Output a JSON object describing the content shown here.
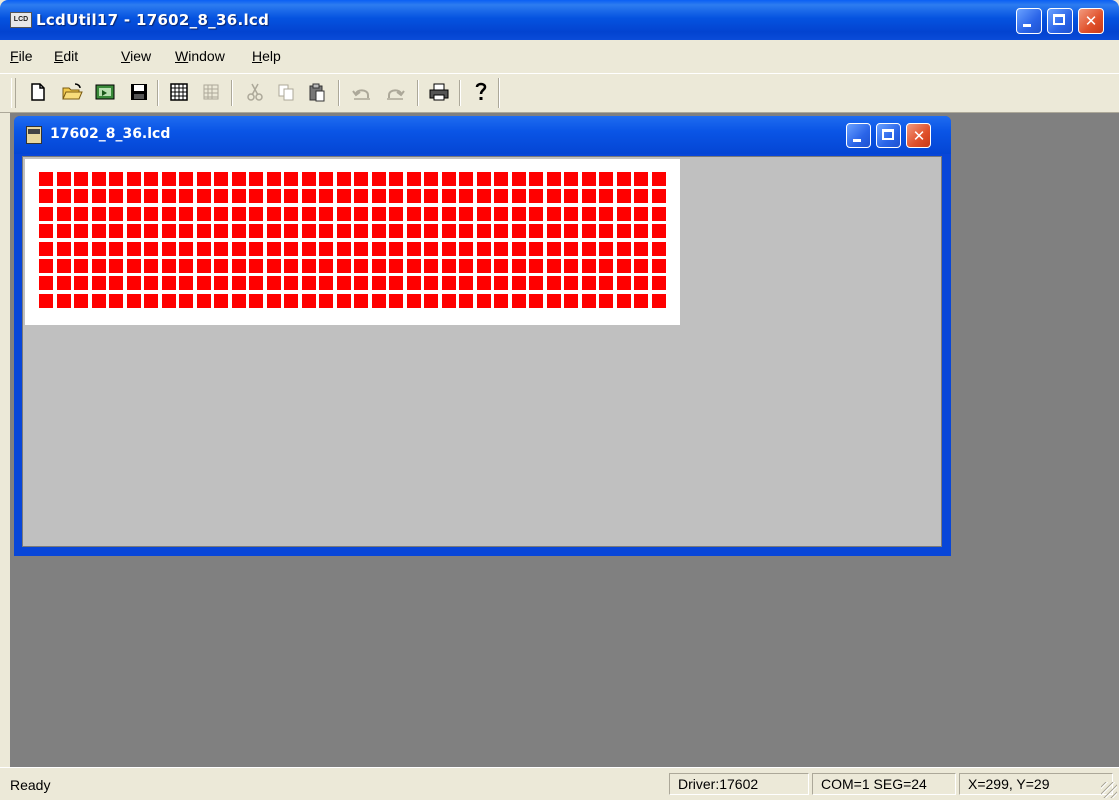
{
  "app": {
    "title": "LcdUtil17 - 17602_8_36.lcd",
    "icon_label": "LCD",
    "icon": "lcd-app-icon"
  },
  "menubar": {
    "items": [
      {
        "label": "File",
        "mnemonic": "F",
        "rest": "ile"
      },
      {
        "label": "Edit",
        "mnemonic": "E",
        "rest": "dit"
      },
      {
        "label": "View",
        "mnemonic": "V",
        "rest": "iew"
      },
      {
        "label": "Window",
        "mnemonic": "W",
        "rest": "indow"
      },
      {
        "label": "Help",
        "mnemonic": "H",
        "rest": "elp"
      }
    ]
  },
  "toolbar": {
    "buttons": [
      {
        "name": "new",
        "icon": "new-document-icon",
        "enabled": true
      },
      {
        "name": "open",
        "icon": "open-folder-icon",
        "enabled": true
      },
      {
        "name": "import",
        "icon": "import-image-icon",
        "enabled": true
      },
      {
        "name": "save",
        "icon": "save-disk-icon",
        "enabled": true
      },
      {
        "name": "grid",
        "icon": "grid-icon",
        "enabled": true
      },
      {
        "name": "grid-alt",
        "icon": "grid-alt-icon",
        "enabled": false
      },
      {
        "name": "cut",
        "icon": "cut-icon",
        "enabled": false
      },
      {
        "name": "copy",
        "icon": "copy-icon",
        "enabled": false
      },
      {
        "name": "paste",
        "icon": "paste-icon",
        "enabled": true
      },
      {
        "name": "undo",
        "icon": "undo-icon",
        "enabled": false
      },
      {
        "name": "redo",
        "icon": "redo-icon",
        "enabled": false
      },
      {
        "name": "print",
        "icon": "print-icon",
        "enabled": true
      },
      {
        "name": "help",
        "icon": "help-icon",
        "enabled": true
      }
    ]
  },
  "child_window": {
    "title": "17602_8_36.lcd",
    "icon": "lcd-document-icon"
  },
  "lcd": {
    "rows": 8,
    "columns": 36,
    "segment_color": "#ff0000",
    "background_color": "#ffffff"
  },
  "statusbar": {
    "status": "Ready",
    "driver": "Driver:17602",
    "com_seg": "COM=1 SEG=24",
    "coords": "X=299, Y=29"
  },
  "colors": {
    "titlebar": "#0553e0",
    "mdi_background": "#808080",
    "client_background": "#c0c0c0",
    "chrome": "#ece9d8"
  }
}
